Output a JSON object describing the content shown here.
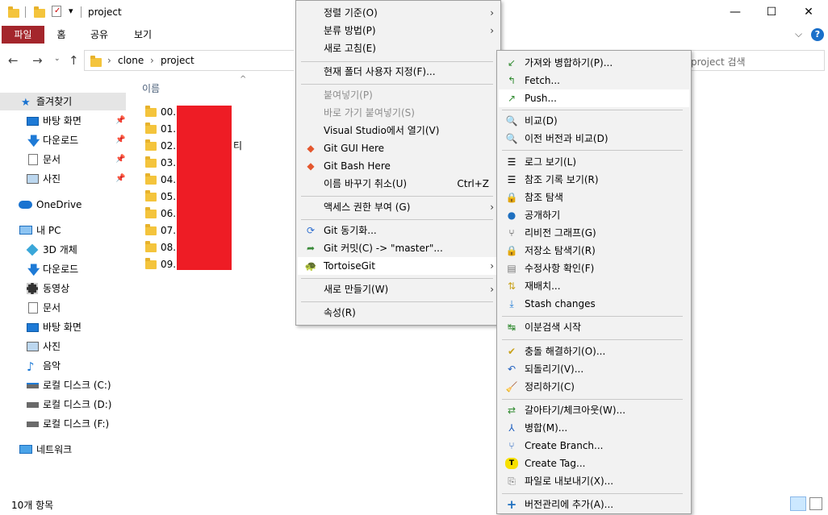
{
  "window": {
    "title": "project",
    "quick_access_arrow": "▾",
    "controls": {
      "minimize": "—",
      "maximize": "☐",
      "close": "✕"
    }
  },
  "ribbon": {
    "tabs": [
      "파일",
      "홈",
      "공유",
      "보기"
    ],
    "collapse": "⌵",
    "help": "?"
  },
  "address": {
    "path": [
      "clone",
      "project"
    ],
    "search_placeholder": "project 검색"
  },
  "sidebar": {
    "quick_access": "즐겨찾기",
    "quick_items": [
      "바탕 화면",
      "다운로드",
      "문서",
      "사진"
    ],
    "onedrive": "OneDrive",
    "this_pc": "내 PC",
    "pc_items": [
      "3D 개체",
      "다운로드",
      "동영상",
      "문서",
      "바탕 화면",
      "사진",
      "음악",
      "로컬 디스크 (C:)",
      "로컬 디스크 (D:)",
      "로컬 디스크 (F:)"
    ],
    "network": "네트워크"
  },
  "file_list": {
    "column_name": "이름",
    "rows": [
      "00.",
      "01.",
      "02.",
      "03.",
      "04.",
      "05.",
      "06.S",
      "07.M",
      "08.",
      "09."
    ],
    "row2_suffix": "티"
  },
  "status": {
    "count": "10개 항목"
  },
  "context_menu": {
    "items": [
      {
        "label": "정렬 기준(O)",
        "submenu": true
      },
      {
        "label": "분류 방법(P)",
        "submenu": true
      },
      {
        "label": "새로 고침(E)"
      },
      {
        "label": "현재 폴더 사용자 지정(F)..."
      },
      {
        "label": "붙여넣기(P)",
        "disabled": true
      },
      {
        "label": "바로 가기 붙여넣기(S)",
        "disabled": true
      },
      {
        "label": "Visual Studio에서 열기(V)"
      },
      {
        "label": "Git GUI Here"
      },
      {
        "label": "Git Bash Here"
      },
      {
        "label": "이름 바꾸기 취소(U)",
        "accel": "Ctrl+Z"
      },
      {
        "label": "액세스 권한 부여 (G)",
        "submenu": true
      },
      {
        "label": "Git 동기화..."
      },
      {
        "label": "Git 커밋(C) -> \"master\"..."
      },
      {
        "label": "TortoiseGit",
        "submenu": true
      },
      {
        "label": "새로 만들기(W)",
        "submenu": true
      },
      {
        "label": "속성(R)"
      }
    ]
  },
  "tortoise_menu": {
    "items": [
      "가져와 병합하기(P)...",
      "Fetch...",
      "Push...",
      "비교(D)",
      "이전 버전과 비교(D)",
      "로그 보기(L)",
      "참조 기록 보기(R)",
      "참조 탐색",
      "공개하기",
      "리비전 그래프(G)",
      "저장소 탐색기(R)",
      "수정사항 확인(F)",
      "재배치...",
      "Stash changes",
      "이분검색 시작",
      "충돌 해결하기(O)...",
      "되돌리기(V)...",
      "정리하기(C)",
      "갈아타기/체크아웃(W)...",
      "병합(M)...",
      "Create Branch...",
      "Create Tag...",
      "파일로 내보내기(X)...",
      "버전관리에 추가(A)..."
    ]
  },
  "colors": {
    "file_tab": "#a4262c",
    "redaction": "#ee1c25",
    "menu_bg": "#f2f2f2",
    "selected": "#cce8ff"
  }
}
